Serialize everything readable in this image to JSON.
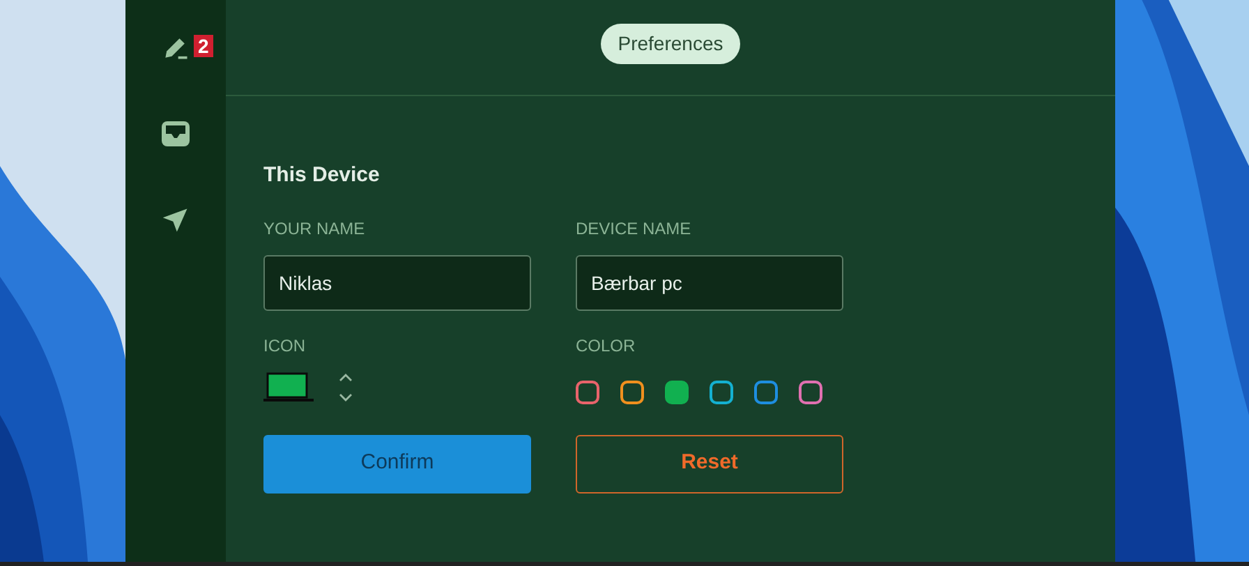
{
  "sidebar": {
    "items": [
      {
        "kind": "pencil",
        "badge": "2"
      },
      {
        "kind": "inbox"
      },
      {
        "kind": "send"
      }
    ]
  },
  "header": {
    "pill": "Preferences"
  },
  "section": {
    "title": "This Device"
  },
  "fields": [
    {
      "label": "YOUR NAME",
      "value": "Niklas"
    },
    {
      "label": "DEVICE NAME",
      "value": "Bærbar pc"
    }
  ],
  "icon_picker": {
    "label": "ICON"
  },
  "color_picker": {
    "label": "COLOR",
    "colors": [
      {
        "color": "#e8636b",
        "selected": false
      },
      {
        "color": "#f0901e",
        "selected": false
      },
      {
        "color": "#11b050",
        "selected": true
      },
      {
        "color": "#14b0d0",
        "selected": false
      },
      {
        "color": "#1e8ee0",
        "selected": false
      },
      {
        "color": "#e070b0",
        "selected": false
      }
    ]
  },
  "buttons": [
    {
      "kind": "primary",
      "label": "Confirm"
    },
    {
      "kind": "outline",
      "label": "Reset"
    }
  ]
}
